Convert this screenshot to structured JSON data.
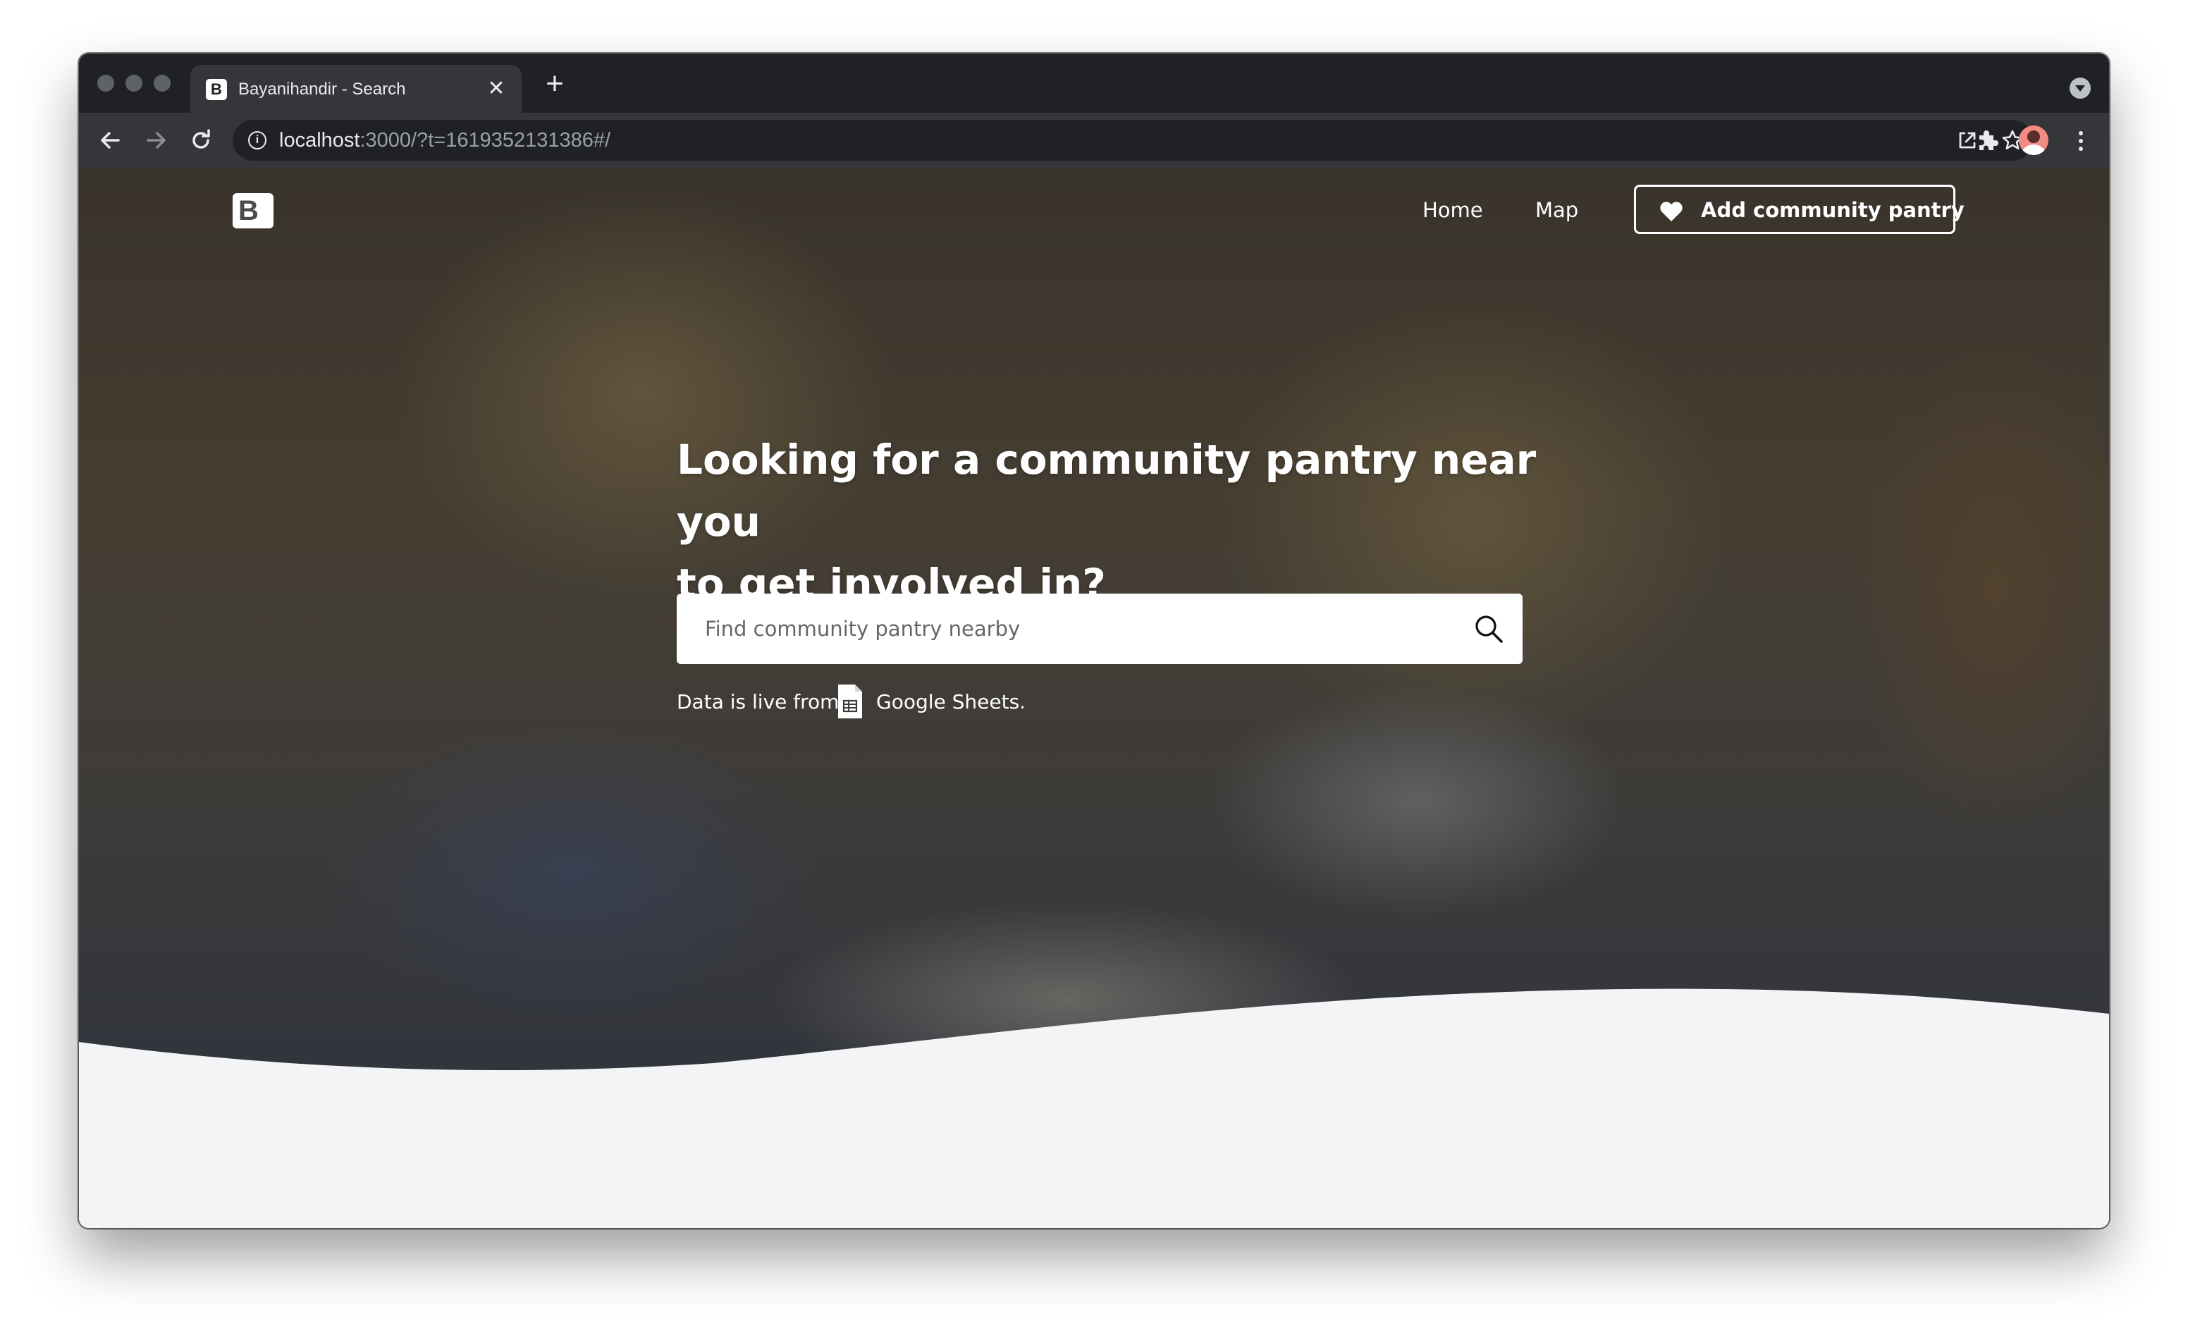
{
  "browser": {
    "tab": {
      "title": "Bayanihandir - Search",
      "favicon_letter": "B",
      "close_symbol": "✕"
    },
    "new_tab_symbol": "+",
    "address": {
      "host": "localhost",
      "rest": ":3000/?t=1619352131386#/"
    }
  },
  "site": {
    "logo_letter": "B",
    "nav": [
      {
        "label": "Home"
      },
      {
        "label": "Map"
      }
    ],
    "cta_label": "Add community pantry"
  },
  "hero": {
    "headline_line1": "Looking for a community pantry near you",
    "headline_line2": "to get involved in?",
    "search_placeholder": "Find community pantry nearby",
    "live_prefix": "Data is live from",
    "live_source": "Google Sheets."
  },
  "colors": {
    "chrome_dark": "#202124",
    "chrome_toolbar": "#35363a",
    "page_background": "#f3f4f6",
    "sheets_icon": "#ffffff"
  },
  "icons": {
    "back": "arrow-left-icon",
    "forward": "arrow-right-icon",
    "reload": "reload-icon",
    "site_info": "info-icon",
    "open_external": "open-in-new-icon",
    "bookmark": "star-icon",
    "extensions": "puzzle-icon",
    "menu": "more-vertical-icon",
    "cta": "heart-icon",
    "search": "search-icon",
    "sheets": "google-sheets-icon"
  }
}
